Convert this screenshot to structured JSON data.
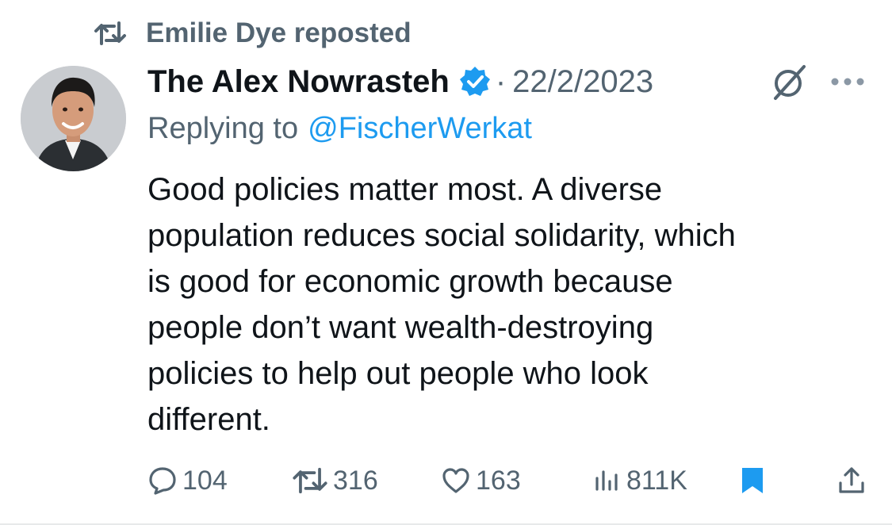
{
  "repost": {
    "text": "Emilie Dye reposted"
  },
  "tweet": {
    "author": "The Alex Nowrasteh",
    "separator": "·",
    "date": "22/2/2023",
    "reply_prefix": "Replying to",
    "reply_handle": "@FischerWerkat",
    "text_lines": [
      "Good policies matter most. A diverse",
      "population reduces social solidarity, which",
      "is good for economic growth because",
      "people don’t want wealth-destroying",
      "policies to help out people who look",
      "different."
    ]
  },
  "actions": {
    "replies": "104",
    "reposts": "316",
    "likes": "163",
    "views": "811K"
  },
  "icons": {
    "repost": "repost-icon",
    "verified": "verified-badge-icon",
    "grok": "grok-icon",
    "more": "more-dots-icon",
    "reply": "reply-bubble-icon",
    "like": "heart-icon",
    "views": "views-chart-icon",
    "bookmark": "bookmark-icon",
    "share": "share-upload-icon"
  },
  "colors": {
    "text": "#0f1419",
    "muted": "#536471",
    "accent": "#1d9bf0"
  }
}
